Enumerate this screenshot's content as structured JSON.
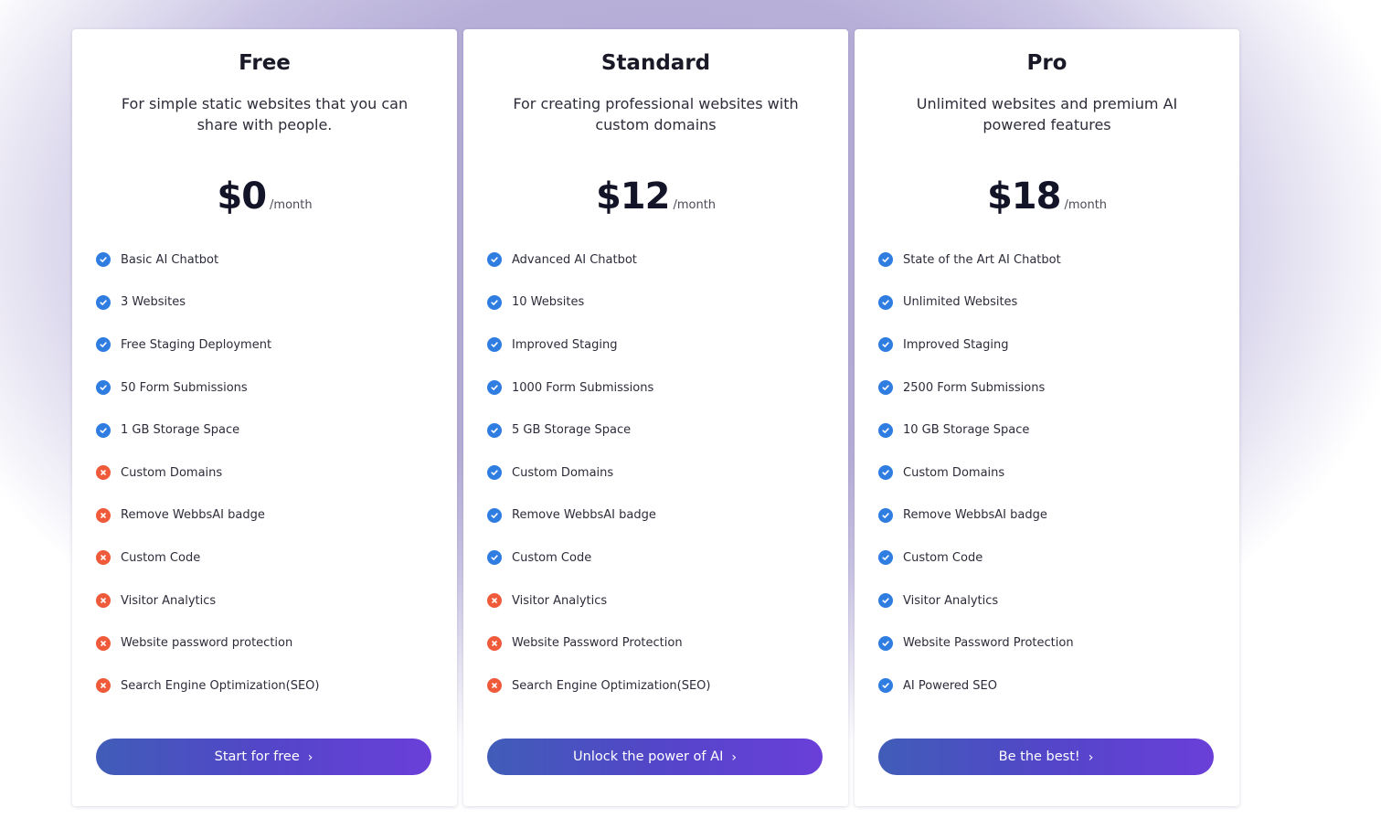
{
  "plans": [
    {
      "name": "Free",
      "description": "For simple static websites that you can share with people.",
      "price": "$0",
      "period": "/month",
      "cta": "Start for free",
      "features": [
        {
          "label": "Basic AI Chatbot",
          "included": true
        },
        {
          "label": "3 Websites",
          "included": true
        },
        {
          "label": "Free Staging Deployment",
          "included": true
        },
        {
          "label": "50 Form Submissions",
          "included": true
        },
        {
          "label": "1 GB Storage Space",
          "included": true
        },
        {
          "label": "Custom Domains",
          "included": false
        },
        {
          "label": "Remove WebbsAI badge",
          "included": false
        },
        {
          "label": "Custom Code",
          "included": false
        },
        {
          "label": "Visitor Analytics",
          "included": false
        },
        {
          "label": "Website password protection",
          "included": false
        },
        {
          "label": "Search Engine Optimization(SEO)",
          "included": false
        }
      ]
    },
    {
      "name": "Standard",
      "description": "For creating professional websites with custom domains",
      "price": "$12",
      "period": "/month",
      "cta": "Unlock the power of AI",
      "features": [
        {
          "label": "Advanced AI Chatbot",
          "included": true
        },
        {
          "label": "10 Websites",
          "included": true
        },
        {
          "label": "Improved Staging",
          "included": true
        },
        {
          "label": "1000 Form Submissions",
          "included": true
        },
        {
          "label": "5 GB Storage Space",
          "included": true
        },
        {
          "label": "Custom Domains",
          "included": true
        },
        {
          "label": "Remove WebbsAI badge",
          "included": true
        },
        {
          "label": "Custom Code",
          "included": true
        },
        {
          "label": "Visitor Analytics",
          "included": false
        },
        {
          "label": "Website Password Protection",
          "included": false
        },
        {
          "label": "Search Engine Optimization(SEO)",
          "included": false
        }
      ]
    },
    {
      "name": "Pro",
      "description": "Unlimited websites and premium AI powered features",
      "price": "$18",
      "period": "/month",
      "cta": "Be the best!",
      "features": [
        {
          "label": "State of the Art AI Chatbot",
          "included": true
        },
        {
          "label": "Unlimited Websites",
          "included": true
        },
        {
          "label": "Improved Staging",
          "included": true
        },
        {
          "label": "2500 Form Submissions",
          "included": true
        },
        {
          "label": "10 GB Storage Space",
          "included": true
        },
        {
          "label": "Custom Domains",
          "included": true
        },
        {
          "label": "Remove WebbsAI badge",
          "included": true
        },
        {
          "label": "Custom Code",
          "included": true
        },
        {
          "label": "Visitor Analytics",
          "included": true
        },
        {
          "label": "Website Password Protection",
          "included": true
        },
        {
          "label": "AI Powered SEO",
          "included": true
        }
      ]
    }
  ],
  "icons": {
    "included": "check-circle-icon",
    "excluded": "x-circle-icon",
    "button_arrow": "chevron-right-icon"
  },
  "colors": {
    "check": "#2f7de1",
    "cross": "#ee5a3a",
    "button_start": "#405db8",
    "button_end": "#6a3fd9",
    "backdrop": "#b4acd6"
  }
}
